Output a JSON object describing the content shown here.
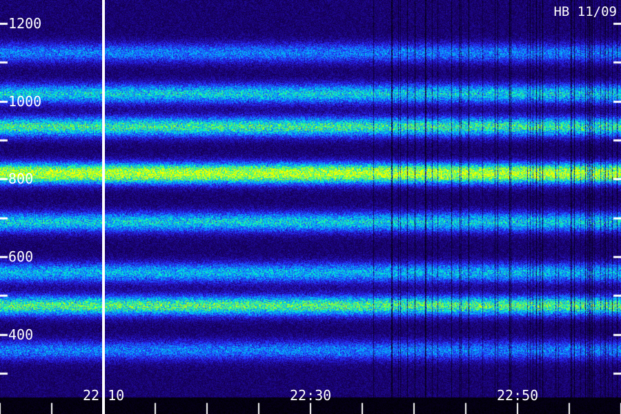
{
  "chart_data": {
    "type": "heatmap",
    "annotation": "HB 11/09",
    "y_axis": {
      "tick_labels": [
        "1200",
        "1000",
        "800",
        "600",
        "400"
      ],
      "tick_values": [
        1200,
        1000,
        800,
        600,
        400
      ],
      "range": [
        240,
        1260
      ],
      "minor_tick_values": [
        1100,
        900,
        700,
        500,
        300
      ]
    },
    "x_axis": {
      "tick_labels": [
        "22:10",
        "22:30",
        "22:50"
      ],
      "range_minutes": [
        "22:00",
        "22:59"
      ],
      "minor_tick_every_minutes": 5
    },
    "marker_time": "22:10",
    "bands": [
      {
        "freq": 1125,
        "level": 0.3
      },
      {
        "freq": 1020,
        "level": 0.45
      },
      {
        "freq": 935,
        "level": 0.55
      },
      {
        "freq": 815,
        "level": 0.85
      },
      {
        "freq": 690,
        "level": 0.45
      },
      {
        "freq": 560,
        "level": 0.4
      },
      {
        "freq": 475,
        "level": 0.6
      },
      {
        "freq": 360,
        "level": 0.3
      }
    ],
    "colormap": [
      "#000000",
      "#1a0070",
      "#2a28ff",
      "#00b4ff",
      "#00ffc0",
      "#b4ff00",
      "#ffff00"
    ]
  }
}
